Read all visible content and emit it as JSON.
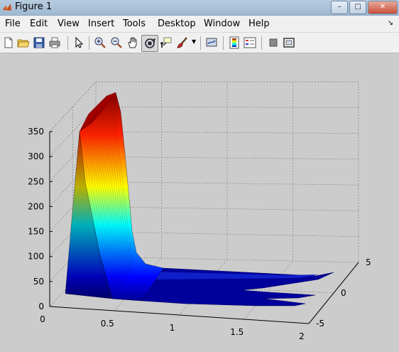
{
  "window": {
    "title": "Figure 1"
  },
  "menu": [
    "File",
    "Edit",
    "View",
    "Insert",
    "Tools",
    "Desktop",
    "Window",
    "Help"
  ],
  "toolbar": [
    "new-figure",
    "open-file",
    "save-figure",
    "print-figure",
    "edit-plot",
    "zoom-in",
    "zoom-out",
    "pan",
    "rotate-3d",
    "data-cursor",
    "brush",
    "link-plot",
    "insert-colorbar",
    "insert-legend",
    "hide-plot-tools",
    "show-plot-tools"
  ],
  "colors": {
    "accent": "#b00000",
    "surface_low": "#00008f",
    "surface_high": "#800000"
  },
  "chart_data": {
    "type": "surface",
    "view": "3d",
    "colormap": "jet",
    "grid": true,
    "xticks": [
      "0",
      "0.5",
      "1",
      "1.5",
      "2"
    ],
    "yticks": [
      "-5",
      "0",
      "5"
    ],
    "zticks": [
      "0",
      "50",
      "100",
      "150",
      "200",
      "250",
      "300",
      "350"
    ],
    "xlim": [
      0,
      2
    ],
    "ylim": [
      -5,
      5
    ],
    "zlim": [
      0,
      350
    ],
    "peak": {
      "x": 0.3,
      "z": 360
    },
    "title": "",
    "xlabel": "",
    "ylabel": "",
    "zlabel": ""
  }
}
